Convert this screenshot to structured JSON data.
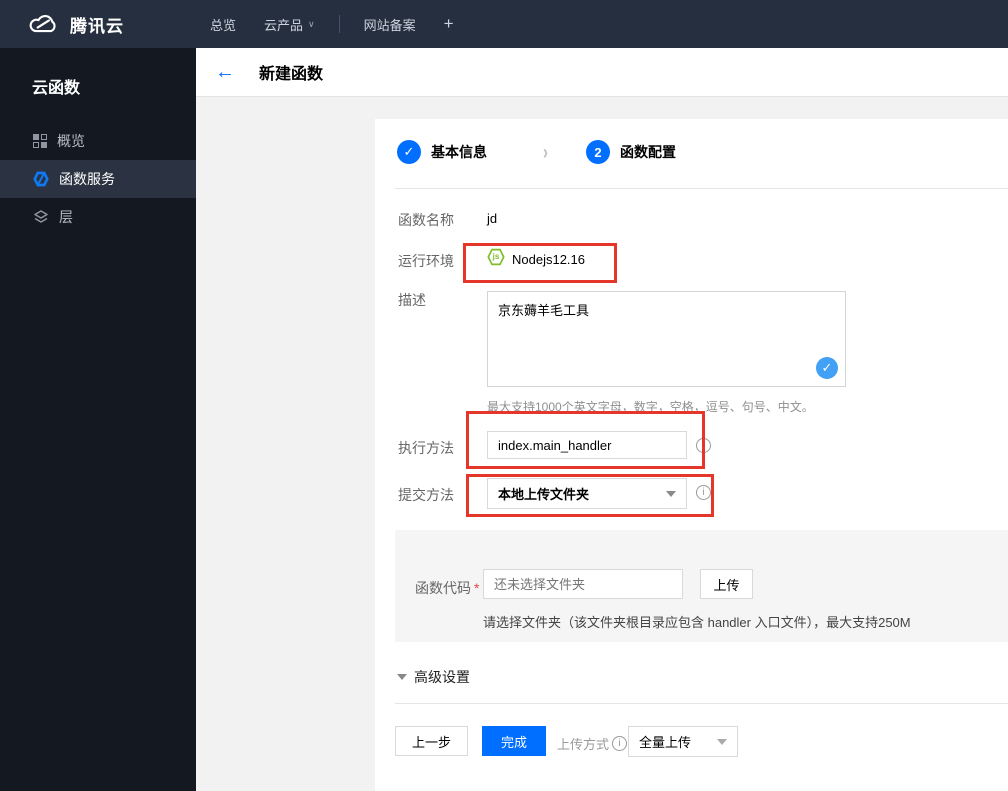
{
  "navbar": {
    "brand": "腾讯云",
    "overview": "总览",
    "products": "云产品",
    "products_caret": "∨",
    "icp": "网站备案",
    "plus": "+"
  },
  "sidebar": {
    "title": "云函数",
    "items": [
      {
        "label": "概览"
      },
      {
        "label": "函数服务"
      },
      {
        "label": "层"
      }
    ]
  },
  "header": {
    "back": "←",
    "title": "新建函数"
  },
  "stepper": {
    "step1_check": "✓",
    "step1_label": "基本信息",
    "chevron": "›",
    "step2_num": "2",
    "step2_label": "函数配置"
  },
  "form": {
    "name_label": "函数名称",
    "name_value": "jd",
    "runtime_label": "运行环境",
    "runtime_icon_text": "js",
    "runtime_value": "Nodejs12.16",
    "desc_label": "描述",
    "desc_value": "京东薅羊毛工具",
    "desc_check": "✓",
    "desc_hint": "最大支持1000个英文字母，数字，空格，逗号、句号、中文。",
    "handler_label": "执行方法",
    "handler_value": "index.main_handler",
    "handler_info": "i",
    "submit_label": "提交方法",
    "submit_value": "本地上传文件夹",
    "submit_info": "i",
    "code_label": "函数代码",
    "required_mark": "*",
    "code_placeholder": "还未选择文件夹",
    "upload_button": "上传",
    "code_hint": "请选择文件夹（该文件夹根目录应包含 handler 入口文件），最大支持250M",
    "advanced_label": "高级设置"
  },
  "footer": {
    "prev": "上一步",
    "finish": "完成",
    "upload_mode_label": "上传方式",
    "upload_mode_info": "i",
    "upload_mode_value": "全量上传"
  },
  "colors": {
    "accent_blue": "#006eff",
    "check_blue": "#42a0f5",
    "navbar_bg": "#262f3f",
    "sidebar_bg": "#141821",
    "active_item_bg": "#2b3342",
    "annotation_red": "#e5362a",
    "nodejs_green": "#7fbe2a"
  }
}
